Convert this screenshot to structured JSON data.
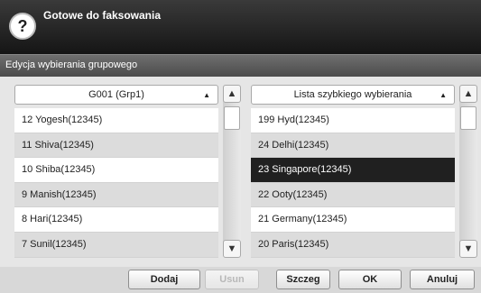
{
  "header": {
    "help_label": "?",
    "status": "Gotowe do faksowania"
  },
  "subtitle": "Edycja wybierania grupowego",
  "left_panel": {
    "dropdown": "G001 (Grp1)",
    "items": [
      {
        "label": "12  Yogesh(12345)"
      },
      {
        "label": "11  Shiva(12345)"
      },
      {
        "label": "10  Shiba(12345)"
      },
      {
        "label": "9  Manish(12345)"
      },
      {
        "label": "8  Hari(12345)"
      },
      {
        "label": "7  Sunil(12345)"
      }
    ]
  },
  "right_panel": {
    "dropdown": "Lista szybkiego wybierania",
    "items": [
      {
        "label": "199  Hyd(12345)"
      },
      {
        "label": "24  Delhi(12345)"
      },
      {
        "label": "23  Singapore(12345)",
        "selected": true
      },
      {
        "label": "22  Ooty(12345)"
      },
      {
        "label": "21  Germany(12345)"
      },
      {
        "label": "20  Paris(12345)"
      }
    ]
  },
  "scroll_icons": {
    "up": "▲",
    "down": "▼",
    "caret": "▲"
  },
  "buttons": {
    "add": "Dodaj",
    "remove": "Usun",
    "details": "Szczeg",
    "ok": "OK",
    "cancel": "Anuluj"
  },
  "colors": {
    "selected_row": "#202020",
    "topbar": "#151515"
  }
}
